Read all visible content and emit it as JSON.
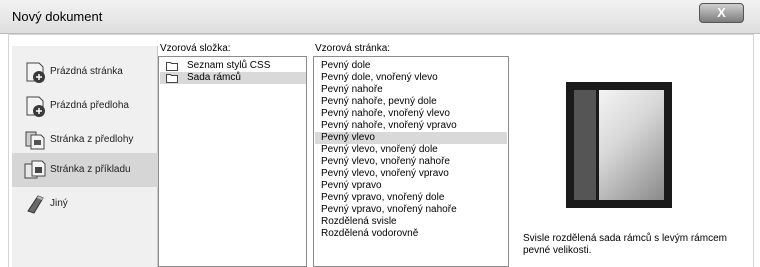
{
  "window": {
    "title": "Nový dokument",
    "close_label": "X"
  },
  "categories": [
    {
      "label": "Prázdná stránka",
      "icon": "blank-page-icon",
      "selected": false
    },
    {
      "label": "Prázdná předloha",
      "icon": "blank-template-icon",
      "selected": false
    },
    {
      "label": "Stránka z předlohy",
      "icon": "page-from-template-icon",
      "selected": false
    },
    {
      "label": "Stránka z příkladu",
      "icon": "page-from-sample-icon",
      "selected": true
    },
    {
      "label": "Jiný",
      "icon": "other-icon",
      "selected": false
    }
  ],
  "sample_folder": {
    "label": "Vzorová složka:",
    "items": [
      {
        "label": "Seznam stylů CSS",
        "selected": false
      },
      {
        "label": "Sada rámců",
        "selected": true
      }
    ]
  },
  "sample_page": {
    "label": "Vzorová stránka:",
    "items": [
      "Pevný dole",
      "Pevný dole, vnořený vlevo",
      "Pevný nahoře",
      "Pevný nahoře, pevný dole",
      "Pevný nahoře, vnořený vlevo",
      "Pevný nahoře, vnořený vpravo",
      "Pevný vlevo",
      "Pevný vlevo, vnořený dole",
      "Pevný vlevo, vnořený nahoře",
      "Pevný vlevo, vnořený vpravo",
      "Pevný vpravo",
      "Pevný vpravo, vnořený dole",
      "Pevný vpravo, vnořený nahoře",
      "Rozdělená svisle",
      "Rozdělená vodorovně"
    ],
    "selected_index": 6
  },
  "preview": {
    "description": "Svisle rozdělená sada rámců s levým rámcem pevné velikosti."
  }
}
